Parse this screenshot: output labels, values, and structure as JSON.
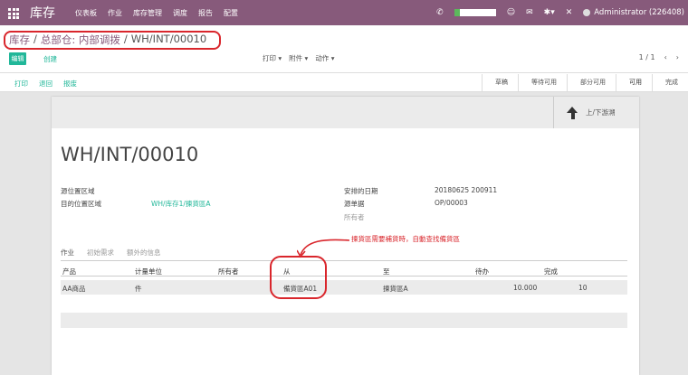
{
  "topbar": {
    "brand": "库存",
    "menu": [
      "仪表板",
      "作业",
      "库存管理",
      "调度",
      "报告",
      "配置"
    ],
    "user": "Administrator (226408)"
  },
  "breadcrumb": {
    "items": [
      "库存",
      "总部仓: 内部调拨"
    ],
    "current": "WH/INT/00010",
    "separator": "/"
  },
  "buttons": {
    "edit": "编辑",
    "create": "创建"
  },
  "actions": [
    "打印 ▾",
    "附件 ▾",
    "动作 ▾"
  ],
  "pager": {
    "value": "1 / 1",
    "prev": "‹",
    "next": "›"
  },
  "statusbar": {
    "buttons": [
      "打印",
      "退回",
      "报废"
    ],
    "stages": [
      "草稿",
      "等待可用",
      "部分可用",
      "可用",
      "完成"
    ],
    "active_stage": "可用"
  },
  "sheet": {
    "updown_label": "上/下游溯",
    "reference": "WH/INT/00010",
    "left_fields": [
      {
        "label": "源位置区域",
        "value": ""
      },
      {
        "label": "目的位置区域",
        "value": "WH/库存1/揀貨區A"
      }
    ],
    "right_fields": [
      {
        "label": "安排的日期",
        "value": "20180625 200911"
      },
      {
        "label": "源单据",
        "value": "OP/00003"
      },
      {
        "label": "所有者",
        "value": ""
      }
    ],
    "tabs": [
      "作业",
      "初始需求",
      "额外的信息"
    ],
    "table": {
      "headers": [
        "产品",
        "计量单位",
        "所有者",
        "从",
        "至",
        "待办",
        "完成"
      ],
      "rows": [
        [
          "AA商品",
          "件",
          "",
          "備貨區A01",
          "揀貨區A",
          "10.000",
          "10"
        ]
      ]
    }
  },
  "annotation": {
    "text": "揀貨區需要補貨時，自動查找備貨區",
    "color": "#d9262c"
  },
  "colors": {
    "brand": "#875a7b",
    "accent": "#21b799"
  }
}
